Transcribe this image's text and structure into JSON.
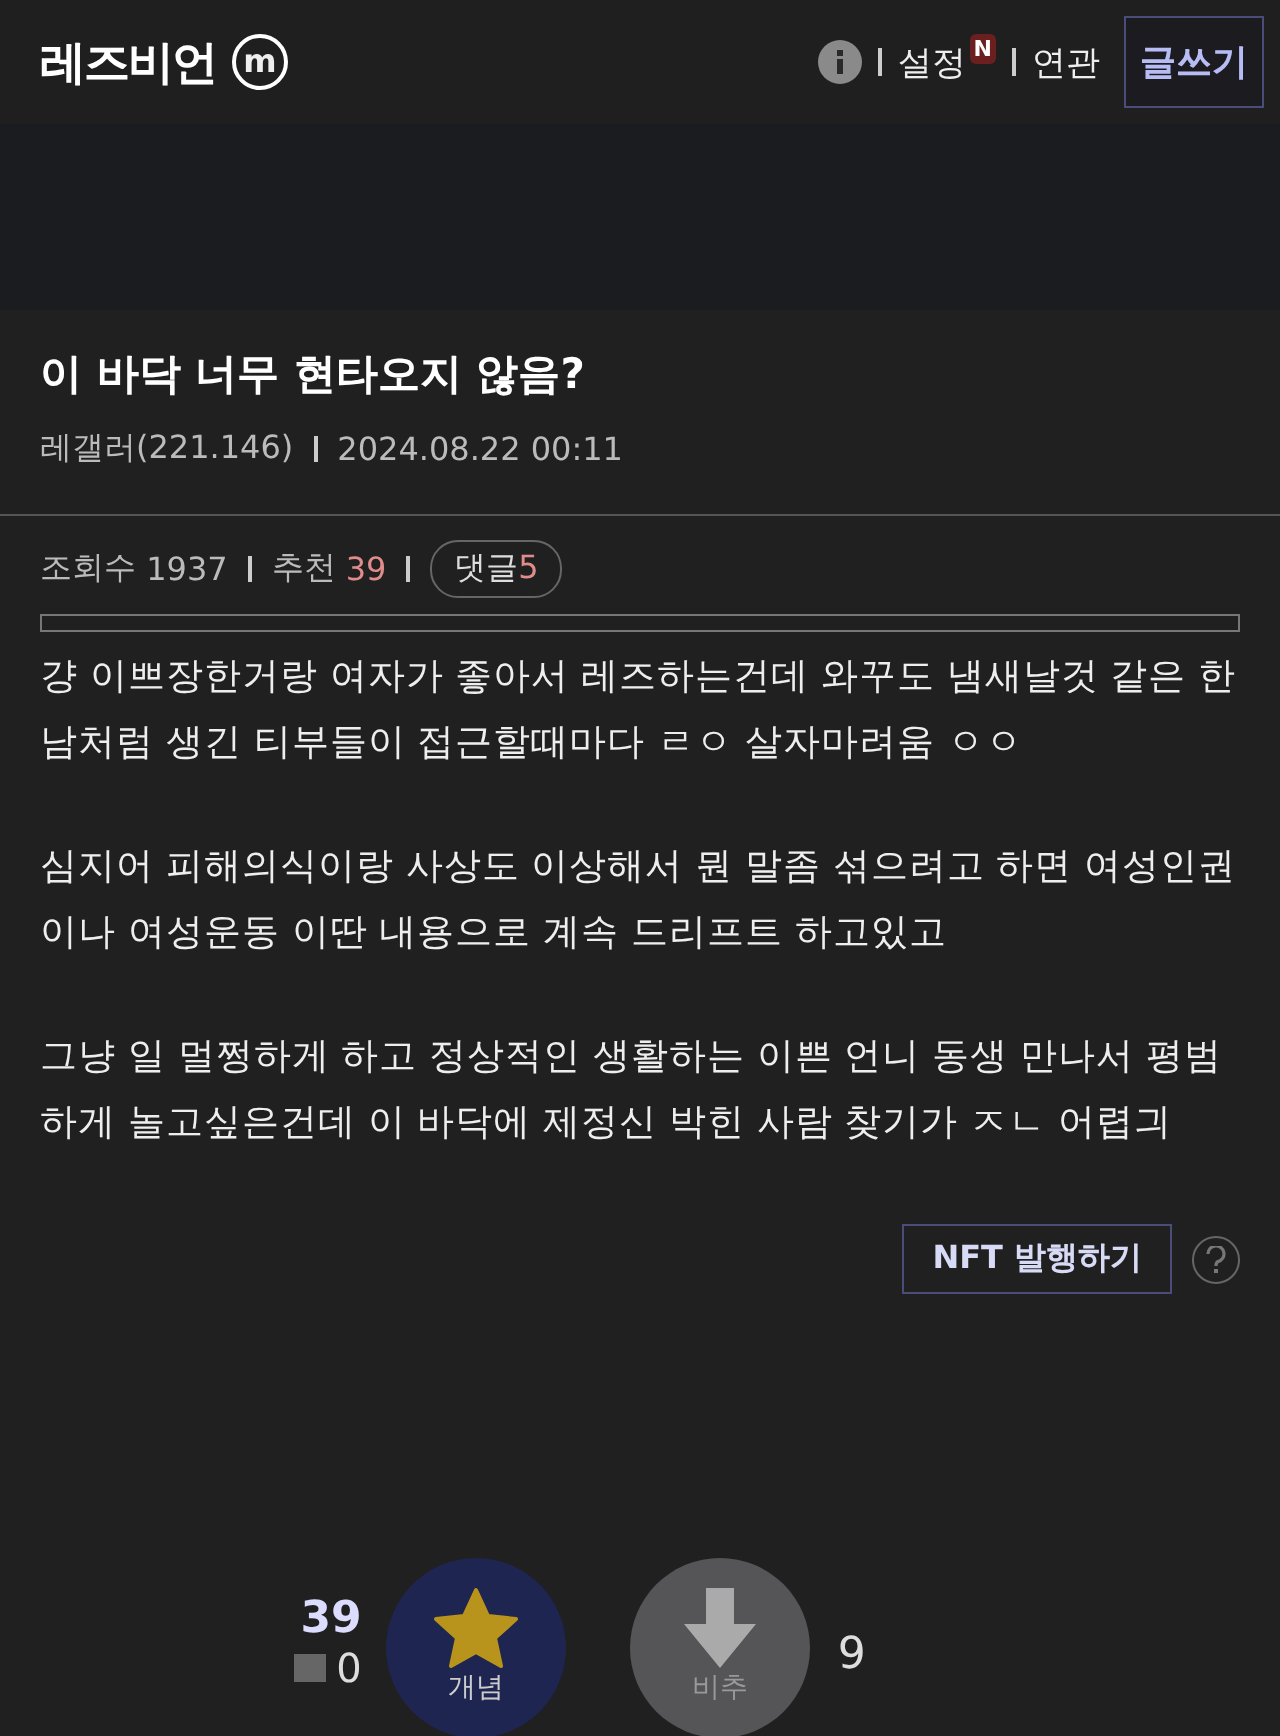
{
  "header": {
    "logo": "레즈비언",
    "logo_mark": "m",
    "links": [
      "설정",
      "연관"
    ],
    "new_badge": "N",
    "write_button": "글쓰기"
  },
  "post": {
    "title": "이 바닥 너무 현타오지 않음?",
    "author": "레갤러(221.146)",
    "date": "2024.08.22 00:11",
    "views_label": "조회수",
    "views": "1937",
    "recommend_label": "추천",
    "recommend": "39",
    "comments_label": "댓글",
    "comments": "5",
    "paragraphs": [
      "걍 이쁘장한거랑 여자가 좋아서 레즈하는건데 와꾸도 냄새날것 같은 한남처럼 생긴 티부들이 접근할때마다 ㄹㅇ 살자마려움 ㅇㅇ",
      "심지어 피해의식이랑 사상도 이상해서 뭔 말좀 섞으려고 하면 여성인권이나 여성운동 이딴 내용으로 계속 드리프트 하고있고",
      "그냥 일 멀쩡하게 하고 정상적인 생활하는 이쁜 언니 동생 만나서 평범하게 놀고싶은건데 이 바닥에 제정신 박힌 사람 찾기가 ㅈㄴ 어렵긔"
    ],
    "nft_button": "NFT 발행하기",
    "vote": {
      "up_count": "39",
      "fixed_count": "0",
      "up_label": "개념",
      "down_label": "비추",
      "down_count": "9"
    }
  }
}
